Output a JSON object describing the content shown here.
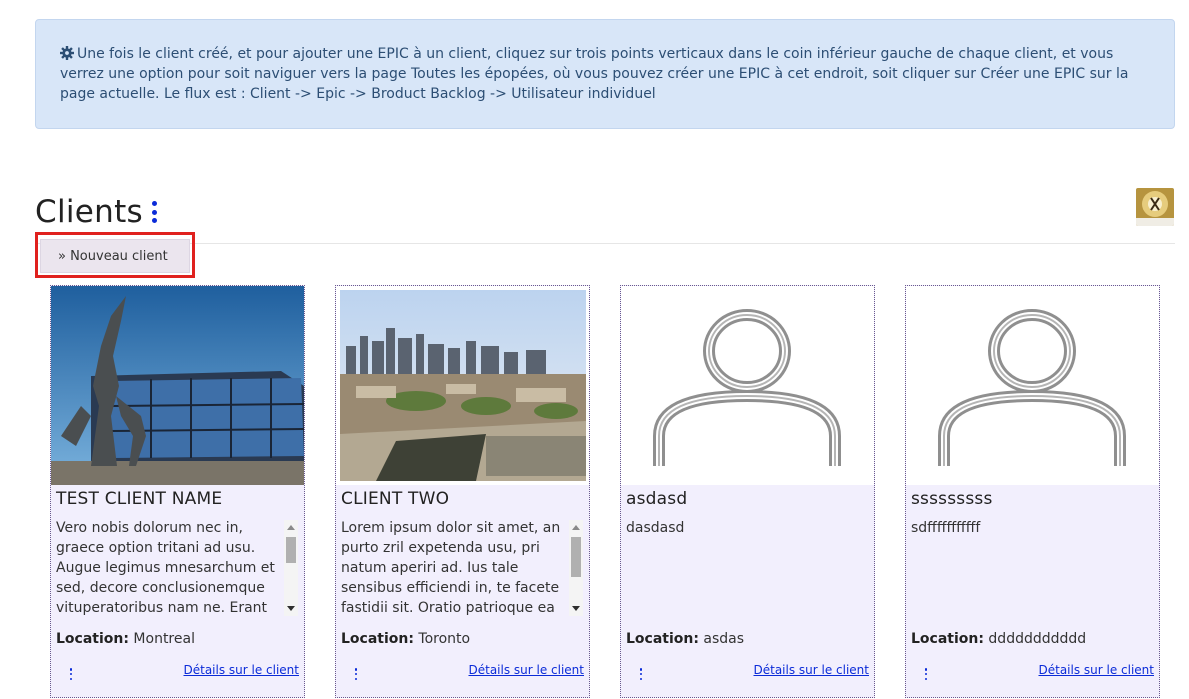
{
  "info": {
    "text": "Une fois le client créé, et pour ajouter une EPIC à un client, cliquez sur trois points verticaux dans le coin inférieur gauche de chaque client, et vous verrez une option pour soit naviguer vers la page Toutes les épopées, où vous pouvez créer une EPIC à cet endroit, soit cliquer sur Créer une EPIC sur la page actuelle. Le flux est : Client -> Epic -> Broduct Backlog -> Utilisateur individuel",
    "icon": "gear-icon"
  },
  "page": {
    "title": "Clients",
    "new_client_label": "» Nouveau client"
  },
  "clients": [
    {
      "name": "TEST CLIENT NAME",
      "description": "Vero nobis dolorum nec in, graece option tritani ad usu. Augue legimus mnesarchum et sed, decore conclusionemque vituperatoribus nam ne. Erant",
      "location_label": "Location:",
      "location": "Montreal",
      "details_label": "Détails sur le client",
      "image": "building-sculpture-photo"
    },
    {
      "name": "CLIENT TWO",
      "description": "Lorem ipsum dolor sit amet, an purto zril expetenda usu, pri natum aperiri ad. Ius tale sensibus efficiendi in, te facete fastidii sit. Oratio patrioque ea",
      "location_label": "Location:",
      "location": "Toronto",
      "details_label": "Détails sur le client",
      "image": "city-skyline-photo"
    },
    {
      "name": "asdasd",
      "description": "dasdasd",
      "location_label": "Location:",
      "location": "asdas",
      "details_label": "Détails sur le client",
      "image": "user-placeholder-icon"
    },
    {
      "name": "sssssssss",
      "description": "sdfffffffffff",
      "location_label": "Location:",
      "location": "ddddddddddd",
      "details_label": "Détails sur le client",
      "image": "user-placeholder-icon"
    }
  ],
  "colors": {
    "info_bg": "#d8e6f8",
    "card_bg": "#f2effd",
    "accent_blue": "#0b2bd8",
    "highlight_red": "#e0211e"
  }
}
